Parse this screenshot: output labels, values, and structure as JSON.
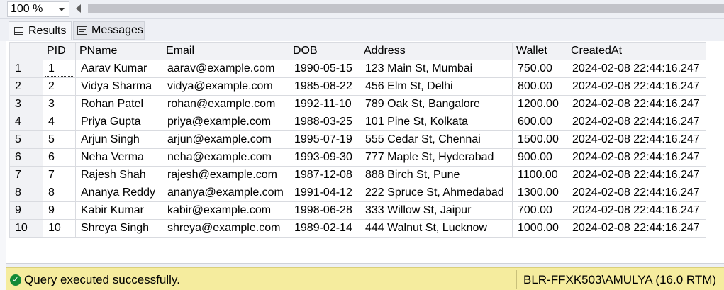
{
  "toolbar": {
    "zoom": "100 %"
  },
  "tabs": [
    {
      "label": "Results",
      "icon": "grid-icon",
      "active": true
    },
    {
      "label": "Messages",
      "icon": "messages-icon",
      "active": false
    }
  ],
  "grid": {
    "columns": [
      "",
      "PID",
      "PName",
      "Email",
      "DOB",
      "Address",
      "Wallet",
      "CreatedAt"
    ],
    "rows": [
      [
        "1",
        "1",
        "Aarav Kumar",
        "aarav@example.com",
        "1990-05-15",
        "123 Main St, Mumbai",
        "750.00",
        "2024-02-08 22:44:16.247"
      ],
      [
        "2",
        "2",
        "Vidya Sharma",
        "vidya@example.com",
        "1985-08-22",
        "456 Elm St, Delhi",
        "800.00",
        "2024-02-08 22:44:16.247"
      ],
      [
        "3",
        "3",
        "Rohan Patel",
        "rohan@example.com",
        "1992-11-10",
        "789 Oak St, Bangalore",
        "1200.00",
        "2024-02-08 22:44:16.247"
      ],
      [
        "4",
        "4",
        "Priya Gupta",
        "priya@example.com",
        "1988-03-25",
        "101 Pine St, Kolkata",
        "600.00",
        "2024-02-08 22:44:16.247"
      ],
      [
        "5",
        "5",
        "Arjun Singh",
        "arjun@example.com",
        "1995-07-19",
        "555 Cedar St, Chennai",
        "1500.00",
        "2024-02-08 22:44:16.247"
      ],
      [
        "6",
        "6",
        "Neha Verma",
        "neha@example.com",
        "1993-09-30",
        "777 Maple St, Hyderabad",
        "900.00",
        "2024-02-08 22:44:16.247"
      ],
      [
        "7",
        "7",
        "Rajesh Shah",
        "rajesh@example.com",
        "1987-12-08",
        "888 Birch St, Pune",
        "1100.00",
        "2024-02-08 22:44:16.247"
      ],
      [
        "8",
        "8",
        "Ananya Reddy",
        "ananya@example.com",
        "1991-04-12",
        "222 Spruce St, Ahmedabad",
        "1300.00",
        "2024-02-08 22:44:16.247"
      ],
      [
        "9",
        "9",
        "Kabir Kumar",
        "kabir@example.com",
        "1998-06-28",
        "333 Willow St, Jaipur",
        "700.00",
        "2024-02-08 22:44:16.247"
      ],
      [
        "10",
        "10",
        "Shreya Singh",
        "shreya@example.com",
        "1989-02-14",
        "444 Walnut St, Lucknow",
        "1000.00",
        "2024-02-08 22:44:16.247"
      ]
    ]
  },
  "status": {
    "icon": "success-check-icon",
    "message": "Query executed successfully.",
    "server": "BLR-FFXK503\\AMULYA (16.0 RTM)",
    "color": "#f5ec9e"
  }
}
